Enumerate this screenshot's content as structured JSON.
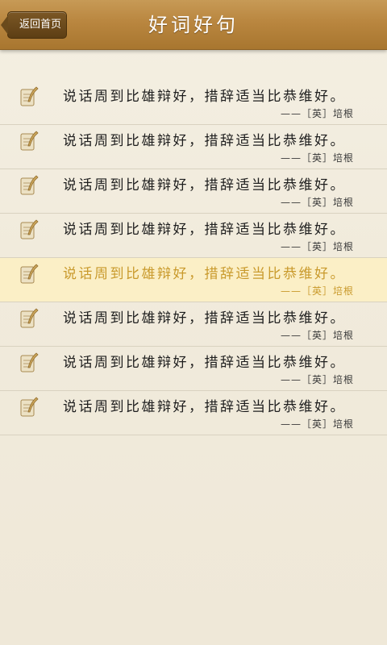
{
  "header": {
    "title": "好词好句",
    "back_label": "返回首页"
  },
  "items": [
    {
      "quote": "说话周到比雄辩好，措辞适当比恭维好。",
      "author": "——［英］培根",
      "icon": "quill-scroll-icon",
      "selected": false
    },
    {
      "quote": "说话周到比雄辩好，措辞适当比恭维好。",
      "author": "——［英］培根",
      "icon": "quill-scroll-icon",
      "selected": false
    },
    {
      "quote": "说话周到比雄辩好，措辞适当比恭维好。",
      "author": "——［英］培根",
      "icon": "quill-scroll-icon",
      "selected": false
    },
    {
      "quote": "说话周到比雄辩好，措辞适当比恭维好。",
      "author": "——［英］培根",
      "icon": "quill-scroll-icon",
      "selected": false
    },
    {
      "quote": "说话周到比雄辩好，措辞适当比恭维好。",
      "author": "——［英］培根",
      "icon": "quill-scroll-icon",
      "selected": true
    },
    {
      "quote": "说话周到比雄辩好，措辞适当比恭维好。",
      "author": "——［英］培根",
      "icon": "quill-scroll-icon",
      "selected": false
    },
    {
      "quote": "说话周到比雄辩好，措辞适当比恭维好。",
      "author": "——［英］培根",
      "icon": "quill-scroll-icon",
      "selected": false
    },
    {
      "quote": "说话周到比雄辩好，措辞适当比恭维好。",
      "author": "——［英］培根",
      "icon": "quill-scroll-icon",
      "selected": false
    }
  ],
  "colors": {
    "header": "#b9863f",
    "selected_background": "#fbefc6",
    "selected_text": "#c99a2c",
    "page_background": "#f1ebdc"
  }
}
